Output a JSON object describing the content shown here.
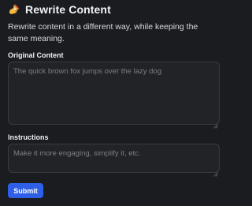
{
  "header": {
    "icon": "writing-hand-icon",
    "title": "Rewrite Content"
  },
  "description": "Rewrite content in a different way, while keeping the same meaning.",
  "form": {
    "original": {
      "label": "Original Content",
      "value": "",
      "placeholder": "The quick brown fox jumps over the lazy dog"
    },
    "instructions": {
      "label": "Instructions",
      "value": "",
      "placeholder": "Make it more engaging, simplify it, etc."
    },
    "submit_label": "Submit"
  },
  "colors": {
    "background": "#1b1c20",
    "field_background": "#222327",
    "accent": "#2f5fe6"
  }
}
